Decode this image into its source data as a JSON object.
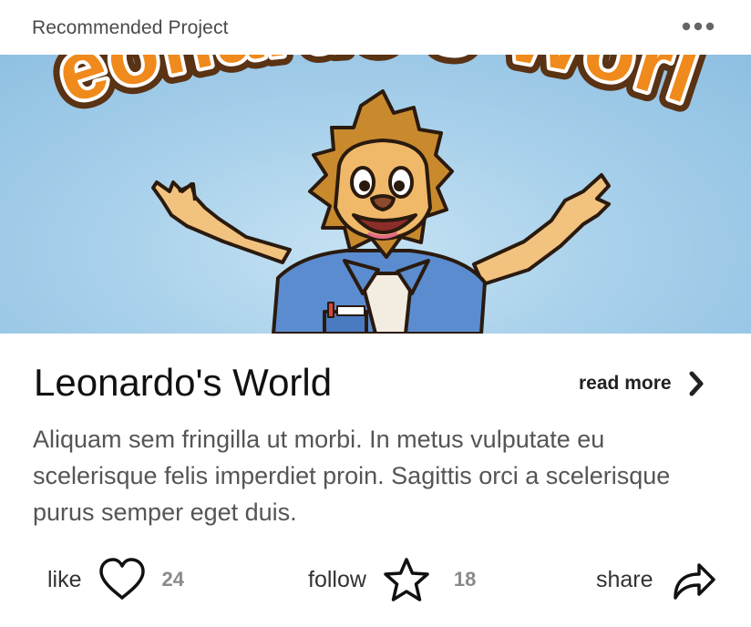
{
  "header": {
    "title": "Recommended Project",
    "more_icon": "more-horizontal-icon"
  },
  "hero": {
    "banner_text": "Leonardo's World",
    "image_subject": "lion-mascot"
  },
  "project": {
    "title": "Leonardo's World",
    "read_more_label": "read more",
    "read_more_icon": "chevron-right-icon",
    "description": "Aliquam sem fringilla ut morbi. In metus vulputate eu scelerisque felis imperdiet proin. Sagittis orci a scelerisque purus semper eget duis."
  },
  "actions": {
    "like": {
      "label": "like",
      "count": "24",
      "icon": "heart-icon"
    },
    "follow": {
      "label": "follow",
      "count": "18",
      "icon": "star-icon"
    },
    "share": {
      "label": "share",
      "icon": "share-arrow-icon"
    }
  },
  "colors": {
    "hero_sky": "#a9d1eb",
    "banner_orange": "#f08a1c",
    "lion_mane": "#c98a2e",
    "shirt_blue": "#5b8ccf",
    "count_gray": "#8a8a8a"
  }
}
